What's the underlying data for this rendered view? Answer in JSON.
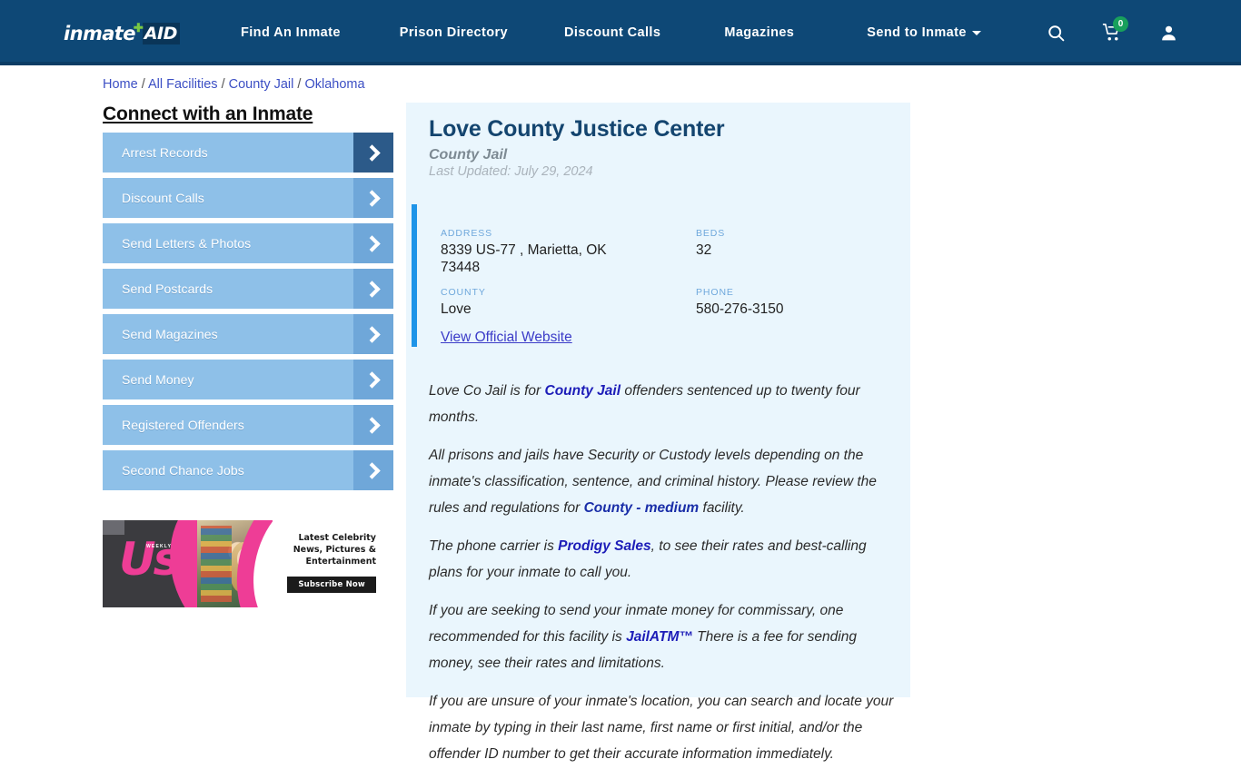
{
  "header": {
    "logo": {
      "word": "inmate",
      "plus": "✚",
      "aid": "AID"
    },
    "nav": [
      {
        "label": "Find An Inmate"
      },
      {
        "label": "Prison Directory"
      },
      {
        "label": "Discount Calls"
      },
      {
        "label": "Magazines"
      },
      {
        "label": "Send to Inmate",
        "has_caret": true
      }
    ],
    "icons": {
      "search": "search-icon",
      "cart": "cart-icon",
      "cart_badge": "0",
      "user": "user-icon"
    },
    "colors": {
      "bg": "#0e4876",
      "badge": "#18a05c",
      "logo_plus": "#7ac943"
    }
  },
  "breadcrumb": {
    "items": [
      "Home",
      "All Facilities",
      "County Jail",
      "Oklahoma"
    ],
    "separator": "/"
  },
  "sidebar": {
    "title": "Connect with an Inmate",
    "items": [
      {
        "label": "Arrest Records",
        "active": true
      },
      {
        "label": "Discount Calls",
        "active": false
      },
      {
        "label": "Send Letters & Photos",
        "active": false
      },
      {
        "label": "Send Postcards",
        "active": false
      },
      {
        "label": "Send Magazines",
        "active": false
      },
      {
        "label": "Send Money",
        "active": false
      },
      {
        "label": "Registered Offenders",
        "active": false
      },
      {
        "label": "Second Chance Jobs",
        "active": false
      }
    ],
    "ad": {
      "brand": "Us",
      "brand_sub": "WEEKLY",
      "headline": "Latest Celebrity News, Pictures & Entertainment",
      "cta": "Subscribe Now"
    }
  },
  "facility": {
    "name": "Love County Justice Center",
    "type": "County Jail",
    "last_updated": "Last Updated: July 29, 2024",
    "info": {
      "address_label": "ADDRESS",
      "address_value": "8339 US-77 , Marietta, OK 73448",
      "beds_label": "BEDS",
      "beds_value": "32",
      "county_label": "COUNTY",
      "county_value": "Love",
      "phone_label": "PHONE",
      "phone_value": "580-276-3150"
    },
    "official_website_link": "View Official Website",
    "paragraphs": {
      "p1_a": "Love Co Jail is for ",
      "p1_link": "County Jail",
      "p1_b": " offenders sentenced up to twenty four months.",
      "p2_a": "All prisons and jails have Security or Custody levels depending on the inmate's classification, sentence, and criminal history. Please review the rules and regulations for ",
      "p2_link": "County - medium",
      "p2_b": " facility.",
      "p3_a": "The phone carrier is ",
      "p3_link": "Prodigy Sales",
      "p3_b": ", to see their rates and best-calling plans for your inmate to call you.",
      "p4_a": "If you are seeking to send your inmate money for commissary, one recommended for this facility is ",
      "p4_link": "JailATM™",
      "p4_b": " There is a fee for sending money, see their rates and limitations.",
      "p5_a": "If you are unsure of your inmate's location, you can search and locate your inmate by typing in their last name, first name or first initial, and/or the offender ID number to get their accurate information immediately."
    }
  }
}
